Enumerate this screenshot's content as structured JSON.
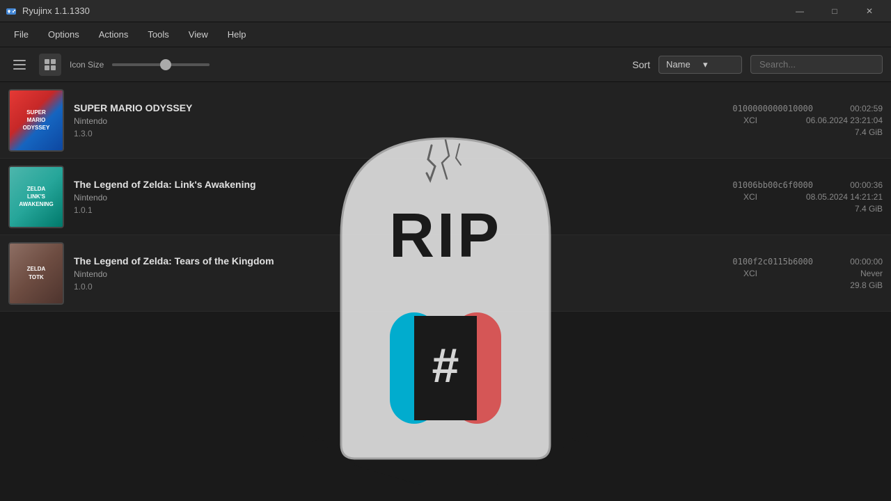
{
  "titlebar": {
    "app_icon": "🎮",
    "title": "Ryujinx 1.1.1330",
    "minimize": "—",
    "maximize": "□",
    "close": "✕"
  },
  "menubar": {
    "items": [
      "File",
      "Options",
      "Actions",
      "Tools",
      "View",
      "Help"
    ]
  },
  "toolbar": {
    "icon_size_label": "Icon Size",
    "slider_value": 55,
    "sort_label": "Sort",
    "sort_value": "Name",
    "search_placeholder": "Search..."
  },
  "games": [
    {
      "title": "SUPER MARIO ODYSSEY",
      "developer": "Nintendo",
      "version": "1.3.0",
      "id": "0100000000010000",
      "time": "00:02:59",
      "format": "XCI",
      "date": "06.06.2024  23:21:04",
      "size": "7.4 GiB",
      "cover_type": "mario"
    },
    {
      "title": "The Legend of Zelda: Link's Awakening",
      "developer": "Nintendo",
      "version": "1.0.1",
      "id": "01006bb00c6f0000",
      "time": "00:00:36",
      "format": "XCI",
      "date": "08.05.2024  14:21:21",
      "size": "7.4 GiB",
      "cover_type": "zelda-la"
    },
    {
      "title": "The Legend of Zelda: Tears of the Kingdom",
      "developer": "Nintendo",
      "version": "1.0.0",
      "id": "0100f2c0115b6000",
      "time": "00:00:00",
      "format": "XCI",
      "date": "Never",
      "size": "29.8 GiB",
      "cover_type": "zelda-totk"
    }
  ],
  "tombstone": {
    "text": "RIP"
  }
}
